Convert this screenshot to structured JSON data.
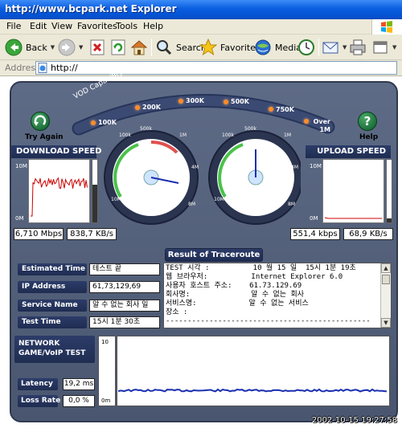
{
  "window": {
    "title": "Explorer",
    "watermark": "http://www.bcpark.net"
  },
  "menu": {
    "items": [
      "File",
      "Edit",
      "View",
      "Favorites",
      "Tools",
      "Help"
    ]
  },
  "toolbar": {
    "back_label": "Back",
    "search_label": "Search",
    "favorites_label": "Favorites",
    "media_label": "Media"
  },
  "address": {
    "label": "Address",
    "value": "http://"
  },
  "vod": {
    "caption": "VOD Capability",
    "marks": [
      "100K",
      "200K",
      "300K",
      "500K",
      "750K",
      "Over 1M"
    ]
  },
  "buttons": {
    "try_again": "Try Again",
    "help": "Help"
  },
  "download": {
    "header": "DOWNLOAD SPEED",
    "axis_top": "10M",
    "axis_bottom": "0M",
    "mbps": "6,710 Mbps",
    "kbs": "838,7 KB/s",
    "level": 0.6
  },
  "upload": {
    "header": "UPLOAD SPEED",
    "axis_top": "10M",
    "axis_bottom": "0M",
    "kbps": "551,4 kbps",
    "kbs": "68,9 KB/s",
    "level": 0.06
  },
  "gauge_labels": {
    "left": [
      "100k",
      "500k",
      "1M",
      "4M",
      "8M",
      "10M"
    ],
    "right": [
      "100k",
      "500k",
      "1M",
      "4M",
      "8M",
      "10M"
    ]
  },
  "traceroute": {
    "header": "Result of Traceroute",
    "lines": [
      "TEST 시각 :          10 월 15 일  15시 1분 19초",
      "웹 브라우저:          Internet Explorer 6.0",
      "사용자 호스트 주소:    61.73.129.69",
      "회사명:              알 수 없는 회사",
      "서비스명:            알 수 없는 서비스",
      "장소 :",
      "-----------------------------------------------"
    ]
  },
  "info": {
    "rows": [
      {
        "label": "Estimated Time",
        "value": "테스트 끝"
      },
      {
        "label": "IP Address",
        "value": "61,73,129,69"
      },
      {
        "label": "Service Name",
        "value": "알 수 없는 회사 일"
      },
      {
        "label": "Test Time",
        "value": "15시 1분 30초"
      }
    ]
  },
  "network": {
    "title_line1": "NETWORK",
    "title_line2": "GAME/VoIP TEST",
    "axis_top": "10",
    "axis_bottom": "0m",
    "latency_label": "Latency",
    "latency_value": "19,2 ms",
    "loss_label": "Loss Rate",
    "loss_value": "0,0 %"
  },
  "timestamp": "2002-10-15 19:27:58",
  "colors": {
    "panel": "#515d78",
    "label_bg": "#25345c",
    "vod_dot": "#ff8c2a",
    "graph_red": "#cc0000",
    "graph_blue": "#1a2fb0"
  }
}
